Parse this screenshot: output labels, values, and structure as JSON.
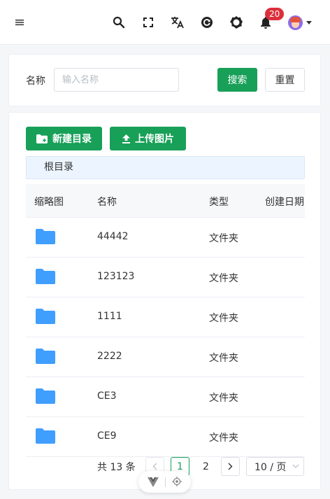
{
  "header": {
    "notification_count": "20",
    "icons": [
      "menu-icon",
      "search-icon",
      "fullscreen-icon",
      "translate-icon",
      "refresh-icon",
      "settings-icon",
      "bell-icon",
      "avatar",
      "chevron-down-icon"
    ]
  },
  "search_form": {
    "name_label": "名称",
    "name_placeholder": "输入名称",
    "name_value": "",
    "search_label": "搜索",
    "reset_label": "重置"
  },
  "toolbar": {
    "new_folder_label": "新建目录",
    "upload_label": "上传图片"
  },
  "breadcrumb": "根目录",
  "table": {
    "columns": [
      "缩略图",
      "名称",
      "类型",
      "创建日期"
    ],
    "rows": [
      {
        "name": "44442",
        "type": "文件夹"
      },
      {
        "name": "123123",
        "type": "文件夹"
      },
      {
        "name": "1111",
        "type": "文件夹"
      },
      {
        "name": "2222",
        "type": "文件夹"
      },
      {
        "name": "CE3",
        "type": "文件夹"
      },
      {
        "name": "CE9",
        "type": "文件夹"
      }
    ]
  },
  "pagination": {
    "total_text": "共 13 条",
    "pages": [
      "1",
      "2"
    ],
    "current_page": "1",
    "page_size_label": "10 / 页"
  },
  "colors": {
    "primary": "#18a058",
    "badge": "#dc2f3c",
    "folder": "#409eff",
    "breadcrumb_bg": "#ecf5ff"
  }
}
